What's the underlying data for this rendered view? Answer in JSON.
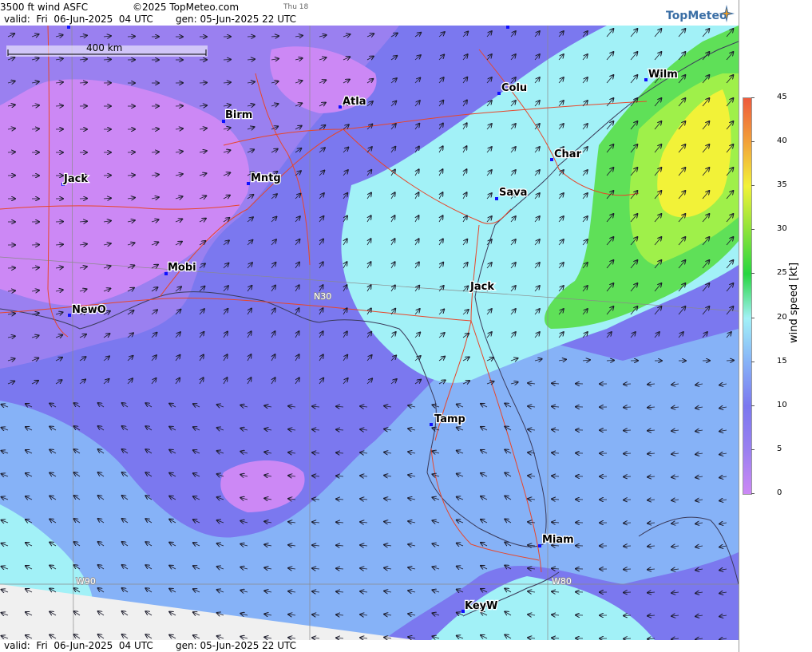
{
  "header": {
    "product": "3500 ft wind ASFC",
    "copyright": "©2025 TopMeteo.com",
    "valid": "valid:  Fri  06-Jun-2025  04 UTC",
    "gen": "gen: 05-Jun-2025 22 UTC",
    "small_tag": "Thu 18"
  },
  "footer": {
    "valid": "valid:  Fri  06-Jun-2025  04 UTC",
    "gen": "gen: 05-Jun-2025 22 UTC"
  },
  "logo": {
    "text": "TopMeteo",
    "icon": "compass-star-icon"
  },
  "scale_bar": {
    "label": "400 km"
  },
  "grid_labels": [
    "N30",
    "W90",
    "W80"
  ],
  "cities": [
    {
      "name": "Jack"
    },
    {
      "name": "Birm"
    },
    {
      "name": "Atla"
    },
    {
      "name": "Colu"
    },
    {
      "name": "Wilm"
    },
    {
      "name": "Char"
    },
    {
      "name": "Sava"
    },
    {
      "name": "Mntg"
    },
    {
      "name": "Mobi"
    },
    {
      "name": "NewO"
    },
    {
      "name": "Jack"
    },
    {
      "name": "Tamp"
    },
    {
      "name": "Miam"
    },
    {
      "name": "KeyW"
    }
  ],
  "legend": {
    "title": "wind speed [kt]",
    "ticks": [
      0,
      5,
      10,
      15,
      20,
      25,
      30,
      35,
      40,
      45
    ],
    "colors": {
      "0": "#cc88f5",
      "5": "#9a80f0",
      "10": "#7b78ef",
      "15": "#86b2f7",
      "20": "#a2f1f7",
      "25": "#27d640",
      "30": "#8ee33a",
      "35": "#f2f238",
      "40": "#f2a13a",
      "45": "#ee5a3c"
    }
  },
  "map_colors": {
    "very_low": "#cc88f5",
    "low": "#9a80f0",
    "mid": "#7b78ef",
    "blue": "#86b2f7",
    "cyan": "#a2f1f7",
    "green": "#5fe058",
    "lime": "#9ff04a",
    "yellow": "#f2f238",
    "nodata": "#f0f0f0",
    "border": "#e8462a",
    "coast": "#3a3a5a",
    "grid": "#8a8a8a"
  }
}
